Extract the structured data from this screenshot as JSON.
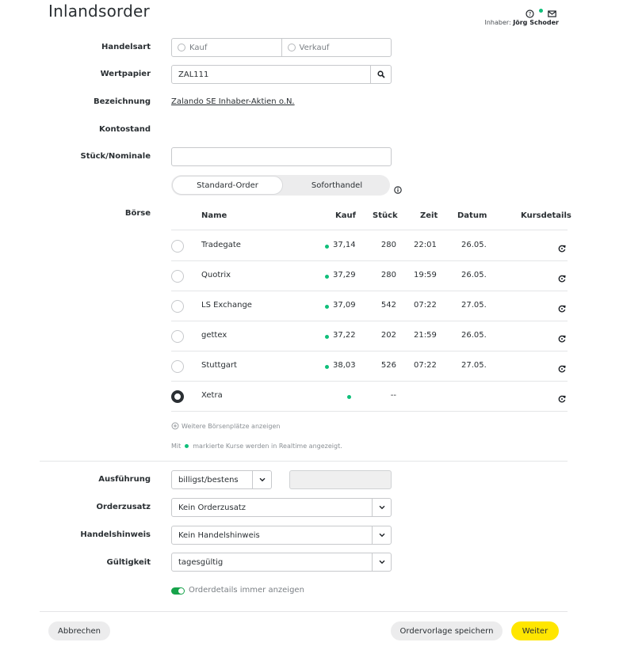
{
  "page": {
    "title": "Inlandsorder"
  },
  "header": {
    "owner_label": "Inhaber:",
    "owner_name": "Jörg Schoder"
  },
  "form": {
    "handelsart_label": "Handelsart",
    "kauf": "Kauf",
    "verkauf": "Verkauf",
    "wertpapier_label": "Wertpapier",
    "wertpapier_value": "ZAL111",
    "bezeichnung_label": "Bezeichnung",
    "bezeichnung_value": "Zalando SE Inhaber-Aktien o.N.",
    "kontostand_label": "Kontostand",
    "stueck_label": "Stück/Nominale",
    "stueck_value": "",
    "ordertyp_standard": "Standard-Order",
    "ordertyp_sofort": "Soforthandel",
    "boerse_label": "Börse"
  },
  "table": {
    "headers": {
      "name": "Name",
      "kauf": "Kauf",
      "stueck": "Stück",
      "zeit": "Zeit",
      "datum": "Datum",
      "kursdetails": "Kursdetails"
    },
    "rows": [
      {
        "name": "Tradegate",
        "kauf": "37,14",
        "stueck": "280",
        "zeit": "22:01",
        "datum": "26.05.",
        "selected": false
      },
      {
        "name": "Quotrix",
        "kauf": "37,29",
        "stueck": "280",
        "zeit": "19:59",
        "datum": "26.05.",
        "selected": false
      },
      {
        "name": "LS Exchange",
        "kauf": "37,09",
        "stueck": "542",
        "zeit": "07:22",
        "datum": "27.05.",
        "selected": false
      },
      {
        "name": "gettex",
        "kauf": "37,22",
        "stueck": "202",
        "zeit": "21:59",
        "datum": "26.05.",
        "selected": false
      },
      {
        "name": "Stuttgart",
        "kauf": "38,03",
        "stueck": "526",
        "zeit": "07:22",
        "datum": "27.05.",
        "selected": false
      },
      {
        "name": "Xetra",
        "kauf": "",
        "stueck": "--",
        "zeit": "",
        "datum": "",
        "selected": true
      }
    ],
    "more_link": "Weitere Börsenplätze anzeigen",
    "realtime_note_pre": "Mit",
    "realtime_note_post": "markierte Kurse werden in Realtime angezeigt."
  },
  "execution": {
    "ausfuehrung_label": "Ausführung",
    "ausfuehrung_value": "billigst/bestens",
    "limit_value": "",
    "orderzusatz_label": "Orderzusatz",
    "orderzusatz_value": "Kein Orderzusatz",
    "handelshinweis_label": "Handelshinweis",
    "handelshinweis_value": "Kein Handelshinweis",
    "gueltigkeit_label": "Gültigkeit",
    "gueltigkeit_value": "tagesgültig",
    "orderdetails_toggle": "Orderdetails immer anzeigen"
  },
  "footer": {
    "cancel": "Abbrechen",
    "save_template": "Ordervorlage speichern",
    "next": "Weiter"
  },
  "colors": {
    "realtime": "#0fbf7a",
    "primary": "#ffe600",
    "toggle_on": "#16a34a"
  }
}
